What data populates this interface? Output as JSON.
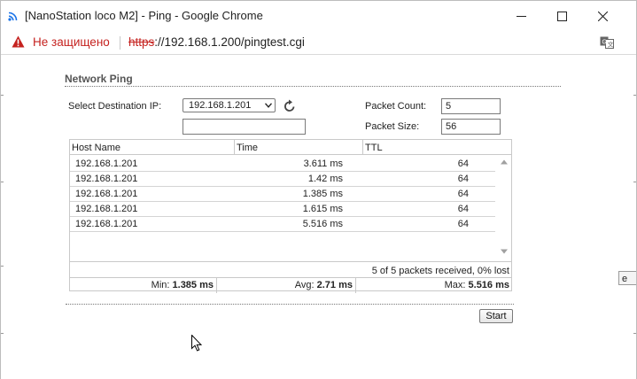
{
  "window": {
    "title": "[NanoStation loco M2] - Ping - Google Chrome"
  },
  "addressbar": {
    "security_text": "Не защищено",
    "url_scheme": "https",
    "url_rest": "://192.168.1.200/pingtest.cgi"
  },
  "ping": {
    "section_title": "Network Ping",
    "dest_label": "Select Destination IP:",
    "dest_selected": "192.168.1.201",
    "extra_ip_value": "",
    "packet_count_label": "Packet Count:",
    "packet_count_value": "5",
    "packet_size_label": "Packet Size:",
    "packet_size_value": "56",
    "columns": [
      "Host Name",
      "Time",
      "TTL"
    ],
    "rows": [
      {
        "host": "192.168.1.201",
        "time": "3.611 ms",
        "ttl": "64"
      },
      {
        "host": "192.168.1.201",
        "time": "1.42 ms",
        "ttl": "64"
      },
      {
        "host": "192.168.1.201",
        "time": "1.385 ms",
        "ttl": "64"
      },
      {
        "host": "192.168.1.201",
        "time": "1.615 ms",
        "ttl": "64"
      },
      {
        "host": "192.168.1.201",
        "time": "5.516 ms",
        "ttl": "64"
      }
    ],
    "summary": "5 of 5 packets received, 0% lost",
    "min_label": "Min: ",
    "min_value": "1.385 ms",
    "avg_label": "Avg: ",
    "avg_value": "2.71 ms",
    "max_label": "Max: ",
    "max_value": "5.516 ms",
    "start_label": "Start",
    "edge_button_label": "e"
  },
  "icons": {
    "favicon": "wifi-icon",
    "security": "warning-icon",
    "refresh": "refresh-icon",
    "translate": "translate-icon"
  },
  "colors": {
    "insecure_red": "#c5221f",
    "favicon_blue": "#1a73e8"
  }
}
